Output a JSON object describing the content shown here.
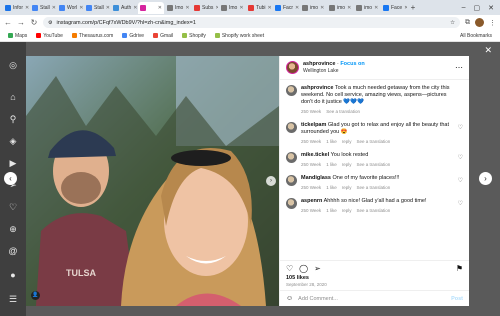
{
  "browser": {
    "tabs": [
      {
        "label": "Infor",
        "color": "#1a73e8"
      },
      {
        "label": "Stall",
        "color": "#4285f4"
      },
      {
        "label": "Worl",
        "color": "#4285f4"
      },
      {
        "label": "Stall",
        "color": "#4285f4"
      },
      {
        "label": "Auth",
        "color": "#3c8fd9"
      },
      {
        "label": "",
        "color": "#d6249f",
        "active": true
      },
      {
        "label": "Imo",
        "color": "#777"
      },
      {
        "label": "Subs",
        "color": "#e53935"
      },
      {
        "label": "Imo",
        "color": "#777"
      },
      {
        "label": "Tubi",
        "color": "#e53935"
      },
      {
        "label": "Facr",
        "color": "#1877f2"
      },
      {
        "label": "imo",
        "color": "#777"
      },
      {
        "label": "imo",
        "color": "#777"
      },
      {
        "label": "imo",
        "color": "#777"
      },
      {
        "label": "Face",
        "color": "#1877f2"
      }
    ],
    "url": "instagram.com/p/CFqf7xWDb9V/?hl=zh-cn&img_index=1",
    "bookmarks": [
      {
        "label": "Maps",
        "color": "#34a853"
      },
      {
        "label": "YouTube",
        "color": "#ff0000"
      },
      {
        "label": "Thesaurus.com",
        "color": "#f57c00"
      },
      {
        "label": "Gdrive",
        "color": "#4285f4"
      },
      {
        "label": "Gmail",
        "color": "#ea4335"
      },
      {
        "label": "Shopify",
        "color": "#95bf47"
      },
      {
        "label": "Shopify work sheet",
        "color": "#95bf47"
      }
    ],
    "all_bookmarks": "All Bookmarks"
  },
  "post": {
    "username": "ashprovince",
    "follow": "Focus on",
    "location": "Wellington Lake",
    "comments": [
      {
        "user": "ashprovince",
        "text": "Took a much needed getaway from the city this weekend. No cell service, amazing views, aspens—pictures don't do it justice 💙💙💙",
        "age": "250 Week",
        "likes": "",
        "reply": "",
        "translation": "See a translation"
      },
      {
        "user": "tickelpam",
        "text": "Glad you got to relax and enjoy all the beauty that surrounded you 😍",
        "age": "250 Week",
        "likes": "1 like",
        "reply": "reply",
        "translation": "See a translation"
      },
      {
        "user": "mike.tickel",
        "text": "You look rested",
        "age": "250 Week",
        "likes": "1 like",
        "reply": "reply",
        "translation": "See a translation"
      },
      {
        "user": "Mandiglass",
        "text": "One of my favorite places!!!",
        "age": "250 Week",
        "likes": "1 like",
        "reply": "reply",
        "translation": "See a translation"
      },
      {
        "user": "aspenrn",
        "text": "Ahhhh so nice! Glad y'all had a good time!",
        "age": "250 Week",
        "likes": "1 like",
        "reply": "reply",
        "translation": "See a translation"
      }
    ],
    "likes": "105 likes",
    "date": "September 28, 2020",
    "add_comment_placeholder": "Add Comment...",
    "post_label": "Post"
  },
  "colors": {
    "accent": "#0095f6",
    "overlay": "#5a5a5a"
  }
}
